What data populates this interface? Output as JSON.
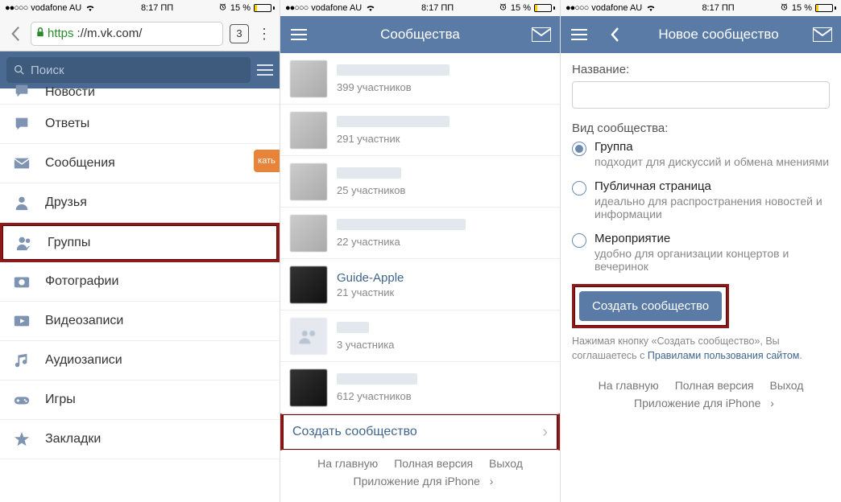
{
  "status": {
    "carrier": "vodafone AU",
    "time": "8:17 ПП",
    "battery": "15 %",
    "signal_dots": "●●○○○"
  },
  "safari": {
    "https": "https",
    "url": "://m.vk.com/",
    "tab_count": "3"
  },
  "pane1": {
    "search_placeholder": "Поиск",
    "menu": [
      {
        "label": "Новости",
        "icon": "speech"
      },
      {
        "label": "Ответы",
        "icon": "reply"
      },
      {
        "label": "Сообщения",
        "icon": "envelope"
      },
      {
        "label": "Друзья",
        "icon": "person"
      },
      {
        "label": "Группы",
        "icon": "people",
        "highlight": true
      },
      {
        "label": "Фотографии",
        "icon": "camera"
      },
      {
        "label": "Видеозаписи",
        "icon": "video"
      },
      {
        "label": "Аудиозаписи",
        "icon": "music"
      },
      {
        "label": "Игры",
        "icon": "gamepad"
      },
      {
        "label": "Закладки",
        "icon": "star"
      }
    ],
    "side_tab": "кать"
  },
  "pane2": {
    "title": "Сообщества",
    "groups": [
      {
        "sub": "399 участников"
      },
      {
        "sub": "291 участник"
      },
      {
        "sub": "25 участников"
      },
      {
        "sub": "22 участника"
      },
      {
        "title": "Guide-Apple",
        "sub": "21 участник",
        "dark": true
      },
      {
        "sub": "3 участника",
        "plain": true
      },
      {
        "sub": "612 участников",
        "dark": true
      }
    ],
    "create": "Создать сообщество",
    "footer": {
      "home": "На главную",
      "full": "Полная версия",
      "exit": "Выход",
      "app": "Приложение для iPhone"
    }
  },
  "pane3": {
    "title": "Новое сообщество",
    "name_label": "Название:",
    "type_label": "Вид сообщества:",
    "options": [
      {
        "label": "Группа",
        "desc": "подходит для дискуссий и обмена мнениями",
        "selected": true
      },
      {
        "label": "Публичная страница",
        "desc": "идеально для распространения новостей и информации"
      },
      {
        "label": "Мероприятие",
        "desc": "удобно для организации концертов и вечеринок"
      }
    ],
    "create_btn": "Создать сообщество",
    "agree_pre": "Нажимая кнопку «Создать сообщество», Вы соглашаетесь с ",
    "agree_link": "Правилами пользования сайтом",
    "footer": {
      "home": "На главную",
      "full": "Полная версия",
      "exit": "Выход",
      "app": "Приложение для iPhone"
    }
  }
}
